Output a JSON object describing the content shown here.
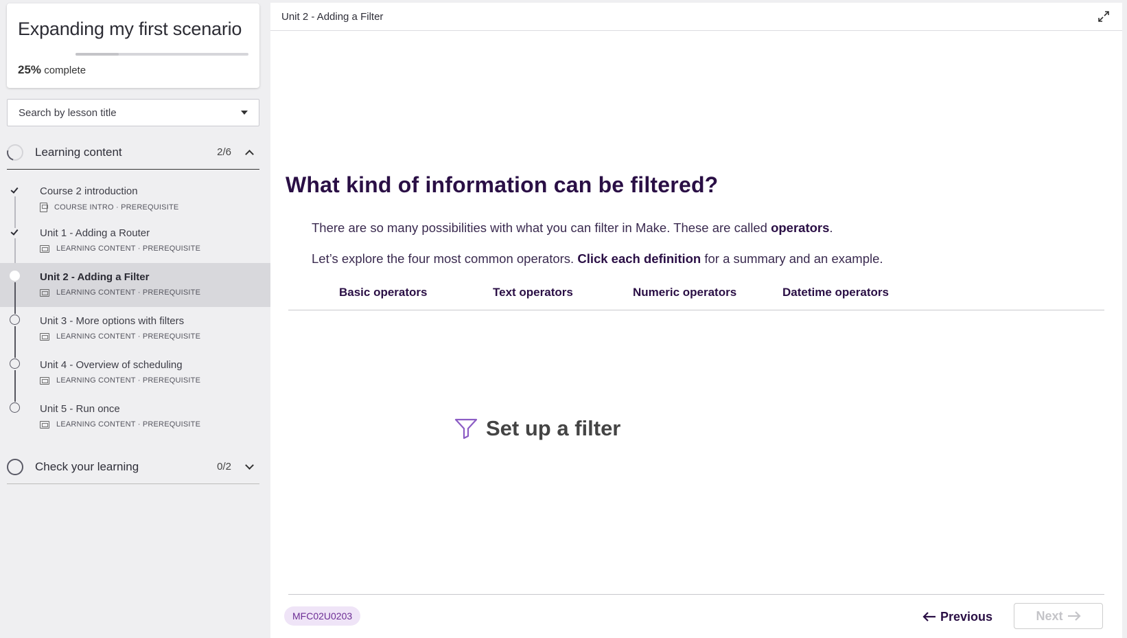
{
  "course": {
    "title": "Expanding my first scenario",
    "progress_fraction": 0.25,
    "progress_pct": "25%",
    "progress_suffix": "complete"
  },
  "search": {
    "placeholder": "Search by lesson title"
  },
  "sections": [
    {
      "title": "Learning content",
      "count": "2/6",
      "expanded": true
    },
    {
      "title": "Check your learning",
      "count": "0/2",
      "expanded": false
    }
  ],
  "lessons": [
    {
      "title": "Course 2 introduction",
      "meta": "COURSE INTRO · PREREQUISITE",
      "status": "done",
      "icon": "document-icon"
    },
    {
      "title": "Unit 1 - Adding a Router",
      "meta": "LEARNING CONTENT · PREREQUISITE",
      "status": "done",
      "icon": "lesson-icon"
    },
    {
      "title": "Unit 2 - Adding a Filter",
      "meta": "LEARNING CONTENT · PREREQUISITE",
      "status": "current",
      "icon": "lesson-icon"
    },
    {
      "title": "Unit 3 - More options with filters",
      "meta": "LEARNING CONTENT · PREREQUISITE",
      "status": "todo",
      "icon": "lesson-icon"
    },
    {
      "title": "Unit 4 - Overview of scheduling",
      "meta": "LEARNING CONTENT · PREREQUISITE",
      "status": "todo",
      "icon": "lesson-icon"
    },
    {
      "title": "Unit 5 - Run once",
      "meta": "LEARNING CONTENT · PREREQUISITE",
      "status": "todo",
      "icon": "lesson-icon"
    }
  ],
  "main": {
    "topbar_title": "Unit 2 - Adding a Filter",
    "heading": "What kind of information can be filtered?",
    "p1_text": "There are so many possibilities with what you can filter in Make. These are called ",
    "p1_bold": "operators",
    "p1_end": ".",
    "p2_start": "Let’s explore the four most common operators. ",
    "p2_bold": "Click each definition",
    "p2_end": " for a summary and an example.",
    "tabs": [
      "Basic operators",
      "Text operators",
      "Numeric operators",
      "Datetime operators"
    ],
    "filter_label": "Set up a filter",
    "code": "MFC02U0203",
    "prev_label": "Previous",
    "next_label": "Next"
  },
  "colors": {
    "accent": "#2a0f45",
    "badge_bg": "#efe4f7",
    "badge_text": "#6c2d94",
    "filter_icon": "#8b5cc4"
  }
}
